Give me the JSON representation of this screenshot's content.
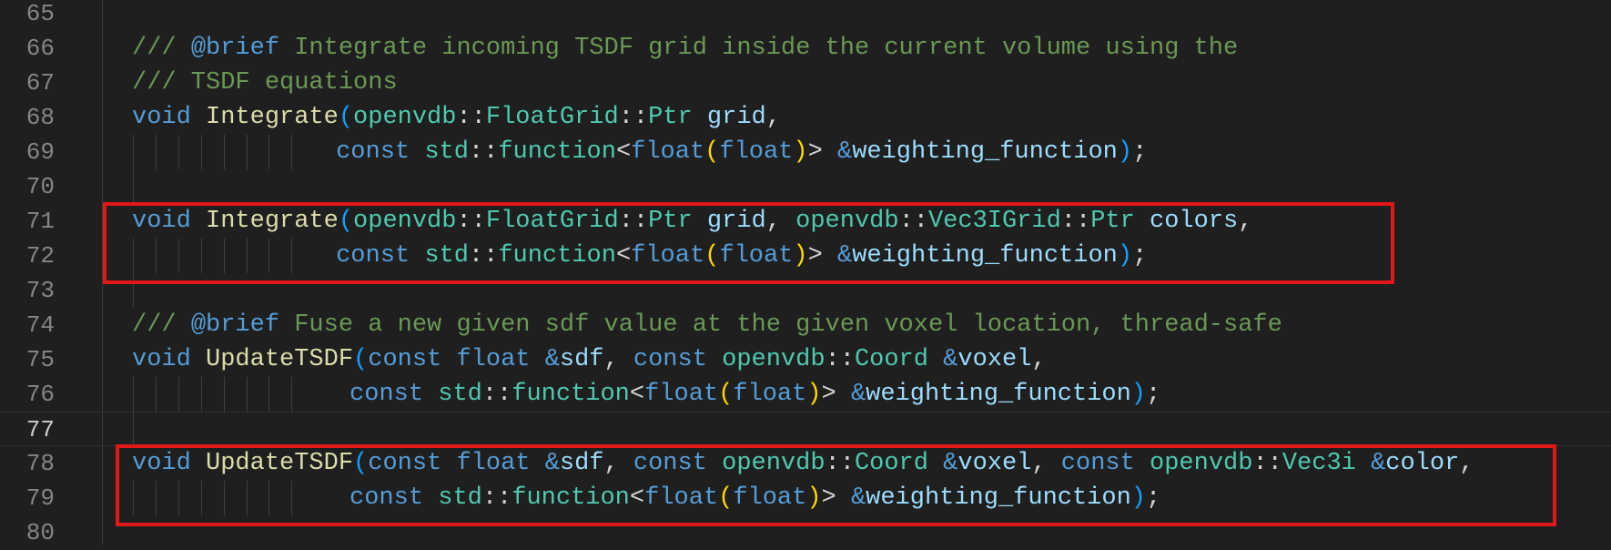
{
  "editor": {
    "lines": [
      {
        "num": "65",
        "tokens": []
      },
      {
        "num": "66",
        "tokens": [
          {
            "t": "comment",
            "v": "/// "
          },
          {
            "t": "doc",
            "v": "@brief"
          },
          {
            "t": "comment",
            "v": " Integrate incoming TSDF grid inside the current volume using the"
          }
        ]
      },
      {
        "num": "67",
        "tokens": [
          {
            "t": "comment",
            "v": "/// TSDF equations"
          }
        ]
      },
      {
        "num": "68",
        "tokens": [
          {
            "t": "kw",
            "v": "void"
          },
          {
            "t": "punct",
            "v": " "
          },
          {
            "t": "fn",
            "v": "Integrate"
          },
          {
            "t": "paren1",
            "v": "("
          },
          {
            "t": "ns",
            "v": "openvdb"
          },
          {
            "t": "punct",
            "v": "::"
          },
          {
            "t": "type",
            "v": "FloatGrid"
          },
          {
            "t": "punct",
            "v": "::"
          },
          {
            "t": "type",
            "v": "Ptr"
          },
          {
            "t": "punct",
            "v": " "
          },
          {
            "t": "id",
            "v": "grid"
          },
          {
            "t": "punct",
            "v": ","
          }
        ]
      },
      {
        "num": "69",
        "guides": 8,
        "indent": 9,
        "tokens": [
          {
            "t": "kw",
            "v": "const"
          },
          {
            "t": "punct",
            "v": " "
          },
          {
            "t": "ns",
            "v": "std"
          },
          {
            "t": "punct",
            "v": "::"
          },
          {
            "t": "type",
            "v": "function"
          },
          {
            "t": "op",
            "v": "<"
          },
          {
            "t": "kw",
            "v": "float"
          },
          {
            "t": "paren2",
            "v": "("
          },
          {
            "t": "kw",
            "v": "float"
          },
          {
            "t": "paren2",
            "v": ")"
          },
          {
            "t": "op",
            "v": "> "
          },
          {
            "t": "amp",
            "v": "&"
          },
          {
            "t": "id",
            "v": "weighting_function"
          },
          {
            "t": "paren1",
            "v": ")"
          },
          {
            "t": "punct",
            "v": ";"
          }
        ]
      },
      {
        "num": "70",
        "guides": 1,
        "tokens": []
      },
      {
        "num": "71",
        "tokens": [
          {
            "t": "kw",
            "v": "void"
          },
          {
            "t": "punct",
            "v": " "
          },
          {
            "t": "fn",
            "v": "Integrate"
          },
          {
            "t": "paren1",
            "v": "("
          },
          {
            "t": "ns",
            "v": "openvdb"
          },
          {
            "t": "punct",
            "v": "::"
          },
          {
            "t": "type",
            "v": "FloatGrid"
          },
          {
            "t": "punct",
            "v": "::"
          },
          {
            "t": "type",
            "v": "Ptr"
          },
          {
            "t": "punct",
            "v": " "
          },
          {
            "t": "id",
            "v": "grid"
          },
          {
            "t": "punct",
            "v": ", "
          },
          {
            "t": "ns",
            "v": "openvdb"
          },
          {
            "t": "punct",
            "v": "::"
          },
          {
            "t": "type",
            "v": "Vec3IGrid"
          },
          {
            "t": "punct",
            "v": "::"
          },
          {
            "t": "type",
            "v": "Ptr"
          },
          {
            "t": "punct",
            "v": " "
          },
          {
            "t": "id",
            "v": "colors"
          },
          {
            "t": "punct",
            "v": ","
          }
        ]
      },
      {
        "num": "72",
        "guides": 8,
        "indent": 9,
        "tokens": [
          {
            "t": "kw",
            "v": "const"
          },
          {
            "t": "punct",
            "v": " "
          },
          {
            "t": "ns",
            "v": "std"
          },
          {
            "t": "punct",
            "v": "::"
          },
          {
            "t": "type",
            "v": "function"
          },
          {
            "t": "op",
            "v": "<"
          },
          {
            "t": "kw",
            "v": "float"
          },
          {
            "t": "paren2",
            "v": "("
          },
          {
            "t": "kw",
            "v": "float"
          },
          {
            "t": "paren2",
            "v": ")"
          },
          {
            "t": "op",
            "v": "> "
          },
          {
            "t": "amp",
            "v": "&"
          },
          {
            "t": "id",
            "v": "weighting_function"
          },
          {
            "t": "paren1",
            "v": ")"
          },
          {
            "t": "punct",
            "v": ";"
          }
        ]
      },
      {
        "num": "73",
        "guides": 1,
        "tokens": []
      },
      {
        "num": "74",
        "tokens": [
          {
            "t": "comment",
            "v": "/// "
          },
          {
            "t": "doc",
            "v": "@brief"
          },
          {
            "t": "comment",
            "v": " Fuse a new given sdf value at the given voxel location, thread-safe"
          }
        ]
      },
      {
        "num": "75",
        "tokens": [
          {
            "t": "kw",
            "v": "void"
          },
          {
            "t": "punct",
            "v": " "
          },
          {
            "t": "fn",
            "v": "UpdateTSDF"
          },
          {
            "t": "paren1",
            "v": "("
          },
          {
            "t": "kw",
            "v": "const"
          },
          {
            "t": "punct",
            "v": " "
          },
          {
            "t": "kw",
            "v": "float"
          },
          {
            "t": "punct",
            "v": " "
          },
          {
            "t": "amp",
            "v": "&"
          },
          {
            "t": "id",
            "v": "sdf"
          },
          {
            "t": "punct",
            "v": ", "
          },
          {
            "t": "kw",
            "v": "const"
          },
          {
            "t": "punct",
            "v": " "
          },
          {
            "t": "ns",
            "v": "openvdb"
          },
          {
            "t": "punct",
            "v": "::"
          },
          {
            "t": "type",
            "v": "Coord"
          },
          {
            "t": "punct",
            "v": " "
          },
          {
            "t": "amp",
            "v": "&"
          },
          {
            "t": "id",
            "v": "voxel"
          },
          {
            "t": "punct",
            "v": ","
          }
        ]
      },
      {
        "num": "76",
        "guides": 8,
        "indent": 9.6,
        "tokens": [
          {
            "t": "kw",
            "v": "const"
          },
          {
            "t": "punct",
            "v": " "
          },
          {
            "t": "ns",
            "v": "std"
          },
          {
            "t": "punct",
            "v": "::"
          },
          {
            "t": "type",
            "v": "function"
          },
          {
            "t": "op",
            "v": "<"
          },
          {
            "t": "kw",
            "v": "float"
          },
          {
            "t": "paren2",
            "v": "("
          },
          {
            "t": "kw",
            "v": "float"
          },
          {
            "t": "paren2",
            "v": ")"
          },
          {
            "t": "op",
            "v": "> "
          },
          {
            "t": "amp",
            "v": "&"
          },
          {
            "t": "id",
            "v": "weighting_function"
          },
          {
            "t": "paren1",
            "v": ")"
          },
          {
            "t": "punct",
            "v": ";"
          }
        ]
      },
      {
        "num": "77",
        "current": true,
        "guides": 1,
        "tokens": []
      },
      {
        "num": "78",
        "tokens": [
          {
            "t": "kw",
            "v": "void"
          },
          {
            "t": "punct",
            "v": " "
          },
          {
            "t": "fn",
            "v": "UpdateTSDF"
          },
          {
            "t": "paren1",
            "v": "("
          },
          {
            "t": "kw",
            "v": "const"
          },
          {
            "t": "punct",
            "v": " "
          },
          {
            "t": "kw",
            "v": "float"
          },
          {
            "t": "punct",
            "v": " "
          },
          {
            "t": "amp",
            "v": "&"
          },
          {
            "t": "id",
            "v": "sdf"
          },
          {
            "t": "punct",
            "v": ", "
          },
          {
            "t": "kw",
            "v": "const"
          },
          {
            "t": "punct",
            "v": " "
          },
          {
            "t": "ns",
            "v": "openvdb"
          },
          {
            "t": "punct",
            "v": "::"
          },
          {
            "t": "type",
            "v": "Coord"
          },
          {
            "t": "punct",
            "v": " "
          },
          {
            "t": "amp",
            "v": "&"
          },
          {
            "t": "id",
            "v": "voxel"
          },
          {
            "t": "punct",
            "v": ", "
          },
          {
            "t": "kw",
            "v": "const"
          },
          {
            "t": "punct",
            "v": " "
          },
          {
            "t": "ns",
            "v": "openvdb"
          },
          {
            "t": "punct",
            "v": "::"
          },
          {
            "t": "type",
            "v": "Vec3i"
          },
          {
            "t": "punct",
            "v": " "
          },
          {
            "t": "amp",
            "v": "&"
          },
          {
            "t": "id",
            "v": "color"
          },
          {
            "t": "punct",
            "v": ","
          }
        ]
      },
      {
        "num": "79",
        "guides": 8,
        "indent": 9.6,
        "tokens": [
          {
            "t": "kw",
            "v": "const"
          },
          {
            "t": "punct",
            "v": " "
          },
          {
            "t": "ns",
            "v": "std"
          },
          {
            "t": "punct",
            "v": "::"
          },
          {
            "t": "type",
            "v": "function"
          },
          {
            "t": "op",
            "v": "<"
          },
          {
            "t": "kw",
            "v": "float"
          },
          {
            "t": "paren2",
            "v": "("
          },
          {
            "t": "kw",
            "v": "float"
          },
          {
            "t": "paren2",
            "v": ")"
          },
          {
            "t": "op",
            "v": "> "
          },
          {
            "t": "amp",
            "v": "&"
          },
          {
            "t": "id",
            "v": "weighting_function"
          },
          {
            "t": "paren1",
            "v": ")"
          },
          {
            "t": "punct",
            "v": ";"
          }
        ]
      },
      {
        "num": "80",
        "tokens": []
      }
    ]
  },
  "annotations": {
    "highlight_color": "#e01818",
    "boxes": [
      {
        "name": "integrate-colors-highlight",
        "from_line": "71",
        "to_line": "72"
      },
      {
        "name": "update-tsdf-color-highlight",
        "from_line": "78",
        "to_line": "79"
      }
    ]
  },
  "theme": {
    "background": "#1f1f1f",
    "comment": "#6a9955",
    "keyword": "#569cd6",
    "function": "#dcdcaa",
    "type": "#4ec9b0",
    "identifier": "#9cdcfe"
  }
}
